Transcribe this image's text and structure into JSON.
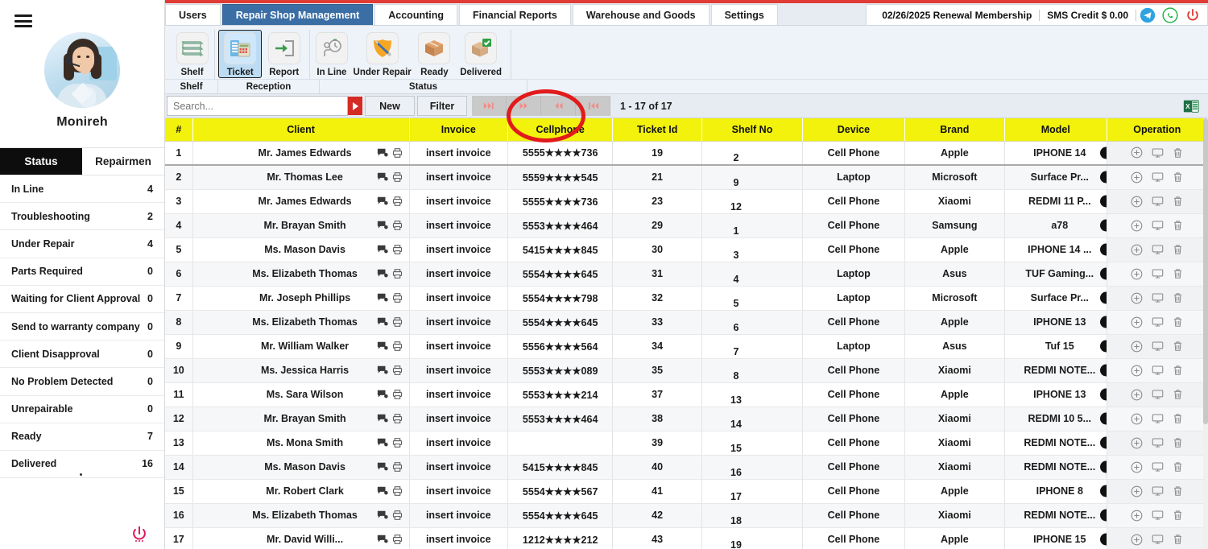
{
  "sidebar": {
    "menu_icon": "hamburger-icon",
    "avatar_alt": "user-avatar",
    "user_name": "Monireh",
    "tabs": [
      {
        "label": "Status",
        "active": true
      },
      {
        "label": "Repairmen",
        "active": false
      }
    ],
    "status_items": [
      {
        "label": "In Line",
        "count": "4"
      },
      {
        "label": "Troubleshooting",
        "count": "2"
      },
      {
        "label": "Under Repair",
        "count": "4"
      },
      {
        "label": "Parts Required",
        "count": "0"
      },
      {
        "label": "Waiting for Client Approval",
        "count": "0"
      },
      {
        "label": "Send to warranty company",
        "count": "0"
      },
      {
        "label": "Client Disapproval",
        "count": "0"
      },
      {
        "label": "No Problem Detected",
        "count": "0"
      },
      {
        "label": "Unrepairable",
        "count": "0"
      },
      {
        "label": "Ready",
        "count": "7"
      },
      {
        "label": "Delivered",
        "count": "16"
      }
    ],
    "power_icon": "power-icon"
  },
  "header": {
    "tabs": [
      {
        "label": "Users",
        "active": false
      },
      {
        "label": "Repair Shop Management",
        "active": true
      },
      {
        "label": "Accounting",
        "active": false
      },
      {
        "label": "Financial Reports",
        "active": false
      },
      {
        "label": "Warehouse and Goods",
        "active": false
      },
      {
        "label": "Settings",
        "active": false
      }
    ],
    "renewal": "02/26/2025 Renewal Membership",
    "sms_credit": "SMS Credit $ 0.00",
    "icons": [
      "telegram-icon",
      "whatsapp-icon",
      "power-icon"
    ]
  },
  "ribbon": {
    "groups": [
      {
        "footer": "Shelf",
        "items": [
          {
            "label": "Shelf",
            "icon": "shelf-icon",
            "selected": false
          }
        ]
      },
      {
        "footer": "Reception",
        "items": [
          {
            "label": "Ticket",
            "icon": "ticket-icon",
            "selected": true
          },
          {
            "label": "Report",
            "icon": "report-icon",
            "selected": false
          }
        ]
      },
      {
        "footer": "Status",
        "items": [
          {
            "label": "In Line",
            "icon": "in-line-icon",
            "selected": false
          },
          {
            "label": "Under Repair",
            "icon": "under-repair-icon",
            "selected": false
          },
          {
            "label": "Ready",
            "icon": "ready-icon",
            "selected": false
          },
          {
            "label": "Delivered",
            "icon": "delivered-icon",
            "selected": false
          }
        ]
      }
    ]
  },
  "toolbar": {
    "search_placeholder": "Search...",
    "search_value": "",
    "search_go_icon": "play-triangle-icon",
    "new_label": "New",
    "filter_label": "Filter",
    "pager_icons": [
      "last-page-icon",
      "next-page-icon",
      "prev-page-icon",
      "first-page-icon"
    ],
    "record_range": "1 - 17 of 17",
    "excel_icon": "excel-export-icon"
  },
  "annotation": {
    "shape": "red-ellipse-highlight",
    "targets": "new-button"
  },
  "table": {
    "columns": [
      "#",
      "Client",
      "Invoice",
      "Cellphone",
      "Ticket Id",
      "Shelf No",
      "Device",
      "Brand",
      "Model",
      "Operation"
    ],
    "row_icons": [
      "chat-icon",
      "print-icon"
    ],
    "shelf_info_icon": "info-icon",
    "operation_icons": [
      "add-circle-icon",
      "monitor-icon",
      "trash-icon"
    ],
    "rows": [
      {
        "n": "1",
        "client": "Mr. James Edwards",
        "invoice": "insert invoice",
        "phone": "5555★★★★736",
        "ticket": "19",
        "shelf": "2",
        "device": "Cell Phone",
        "brand": "Apple",
        "model": "IPHONE 14"
      },
      {
        "n": "2",
        "client": "Mr. Thomas Lee",
        "invoice": "insert invoice",
        "phone": "5559★★★★545",
        "ticket": "21",
        "shelf": "9",
        "device": "Laptop",
        "brand": "Microsoft",
        "model": "Surface Pr..."
      },
      {
        "n": "3",
        "client": "Mr. James Edwards",
        "invoice": "insert invoice",
        "phone": "5555★★★★736",
        "ticket": "23",
        "shelf": "12",
        "device": "Cell Phone",
        "brand": "Xiaomi",
        "model": "REDMI 11 P..."
      },
      {
        "n": "4",
        "client": "Mr. Brayan Smith",
        "invoice": "insert invoice",
        "phone": "5553★★★★464",
        "ticket": "29",
        "shelf": "1",
        "device": "Cell Phone",
        "brand": "Samsung",
        "model": "a78"
      },
      {
        "n": "5",
        "client": "Ms. Mason Davis",
        "invoice": "insert invoice",
        "phone": "5415★★★★845",
        "ticket": "30",
        "shelf": "3",
        "device": "Cell Phone",
        "brand": "Apple",
        "model": "IPHONE 14 ..."
      },
      {
        "n": "6",
        "client": "Ms. Elizabeth Thomas",
        "invoice": "insert invoice",
        "phone": "5554★★★★645",
        "ticket": "31",
        "shelf": "4",
        "device": "Laptop",
        "brand": "Asus",
        "model": "TUF Gaming..."
      },
      {
        "n": "7",
        "client": "Mr. Joseph Phillips",
        "invoice": "insert invoice",
        "phone": "5554★★★★798",
        "ticket": "32",
        "shelf": "5",
        "device": "Laptop",
        "brand": "Microsoft",
        "model": "Surface Pr..."
      },
      {
        "n": "8",
        "client": "Ms. Elizabeth Thomas",
        "invoice": "insert invoice",
        "phone": "5554★★★★645",
        "ticket": "33",
        "shelf": "6",
        "device": "Cell Phone",
        "brand": "Apple",
        "model": "IPHONE 13"
      },
      {
        "n": "9",
        "client": "Mr. William Walker",
        "invoice": "insert invoice",
        "phone": "5556★★★★564",
        "ticket": "34",
        "shelf": "7",
        "device": "Laptop",
        "brand": "Asus",
        "model": "Tuf 15"
      },
      {
        "n": "10",
        "client": "Ms. Jessica Harris",
        "invoice": "insert invoice",
        "phone": "5553★★★★089",
        "ticket": "35",
        "shelf": "8",
        "device": "Cell Phone",
        "brand": "Xiaomi",
        "model": "REDMI NOTE..."
      },
      {
        "n": "11",
        "client": "Ms. Sara Wilson",
        "invoice": "insert invoice",
        "phone": "5553★★★★214",
        "ticket": "37",
        "shelf": "13",
        "device": "Cell Phone",
        "brand": "Apple",
        "model": "IPHONE 13"
      },
      {
        "n": "12",
        "client": "Mr. Brayan Smith",
        "invoice": "insert invoice",
        "phone": "5553★★★★464",
        "ticket": "38",
        "shelf": "14",
        "device": "Cell Phone",
        "brand": "Xiaomi",
        "model": "REDMI 10 5..."
      },
      {
        "n": "13",
        "client": "Ms. Mona Smith",
        "invoice": "insert invoice",
        "phone": "",
        "ticket": "39",
        "shelf": "15",
        "device": "Cell Phone",
        "brand": "Xiaomi",
        "model": "REDMI NOTE..."
      },
      {
        "n": "14",
        "client": "Ms. Mason Davis",
        "invoice": "insert invoice",
        "phone": "5415★★★★845",
        "ticket": "40",
        "shelf": "16",
        "device": "Cell Phone",
        "brand": "Xiaomi",
        "model": "REDMI NOTE..."
      },
      {
        "n": "15",
        "client": "Mr. Robert Clark",
        "invoice": "insert invoice",
        "phone": "5554★★★★567",
        "ticket": "41",
        "shelf": "17",
        "device": "Cell Phone",
        "brand": "Apple",
        "model": "IPHONE 8"
      },
      {
        "n": "16",
        "client": "Ms. Elizabeth Thomas",
        "invoice": "insert invoice",
        "phone": "5554★★★★645",
        "ticket": "42",
        "shelf": "18",
        "device": "Cell Phone",
        "brand": "Xiaomi",
        "model": "REDMI NOTE..."
      },
      {
        "n": "17",
        "client": "Mr. David Willi...",
        "invoice": "insert invoice",
        "phone": "1212★★★★212",
        "ticket": "43",
        "shelf": "19",
        "device": "Cell Phone",
        "brand": "Apple",
        "model": "IPHONE 15"
      }
    ]
  },
  "colors": {
    "header_red": "#e03b34",
    "tab_active": "#3a6ea5",
    "grid_header_yellow": "#f2f20d",
    "annotation_red": "#e11b1b",
    "sidebar_tab_active": "#0d0d0d"
  }
}
